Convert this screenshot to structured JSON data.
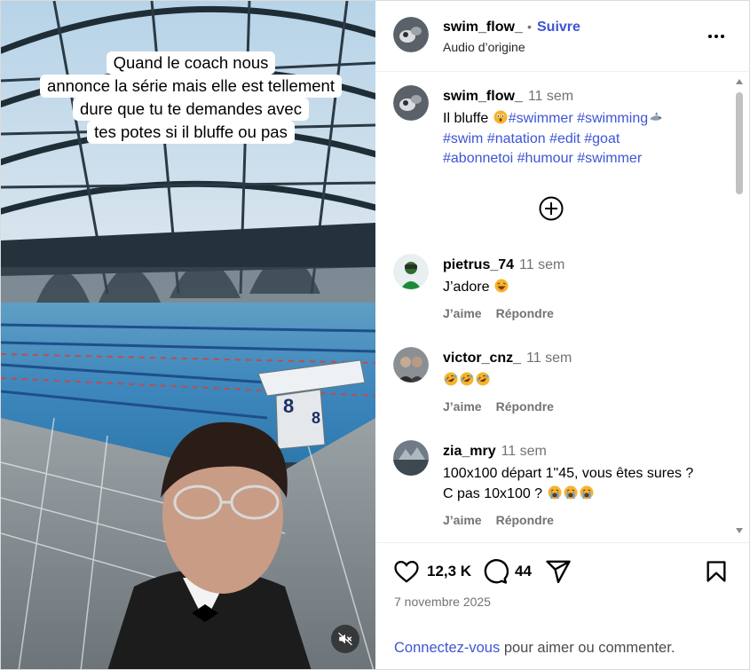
{
  "media": {
    "caption_lines": [
      "Quand le coach nous",
      "annonce la série mais elle est tellement",
      "dure que tu te demandes avec",
      "tes potes si il bluffe ou pas"
    ],
    "block_number": "8",
    "mute_icon": "speaker-muted-icon"
  },
  "header": {
    "username": "swim_flow_",
    "dot": "•",
    "follow_label": "Suivre",
    "audio": "Audio d’origine",
    "more_icon": "more-horizontal-icon"
  },
  "post": {
    "username": "swim_flow_",
    "time": "11 sem",
    "text_before_emoji": "Il bluffe",
    "hashtags_line1": [
      "#swimmer",
      "#swimming"
    ],
    "hashtags_line2": [
      "#swim",
      "#natation",
      "#edit",
      "#goat"
    ],
    "hashtags_line3": [
      "#abonnetoi",
      "#humour",
      "#swimmer"
    ],
    "load_more_icon": "plus-circle-icon"
  },
  "comments": [
    {
      "username": "pietrus_74",
      "time": "11 sem",
      "text": "J’adore",
      "emojis": [
        "laughing-face"
      ],
      "like_label": "J’aime",
      "reply_label": "Répondre"
    },
    {
      "username": "victor_cnz_",
      "time": "11 sem",
      "text": "",
      "emojis": [
        "rofl-face",
        "rofl-face",
        "rofl-face"
      ],
      "like_label": "J’aime",
      "reply_label": "Répondre"
    },
    {
      "username": "zia_mry",
      "time": "11 sem",
      "text_line1": "100x100 départ 1\"45, vous êtes sures ?",
      "text_line2": "C pas 10x100 ?",
      "emojis": [
        "crying-face",
        "crying-face",
        "crying-face"
      ],
      "like_label": "J’aime",
      "reply_label": "Répondre"
    }
  ],
  "actions": {
    "like_count": "12,3 K",
    "comment_count": "44",
    "date": "7 novembre 2025",
    "login_link": "Connectez-vous",
    "login_rest": " pour aimer ou commenter."
  },
  "colors": {
    "link": "#3d55d6",
    "muted_text": "#737373",
    "border": "#dbdbdb"
  }
}
